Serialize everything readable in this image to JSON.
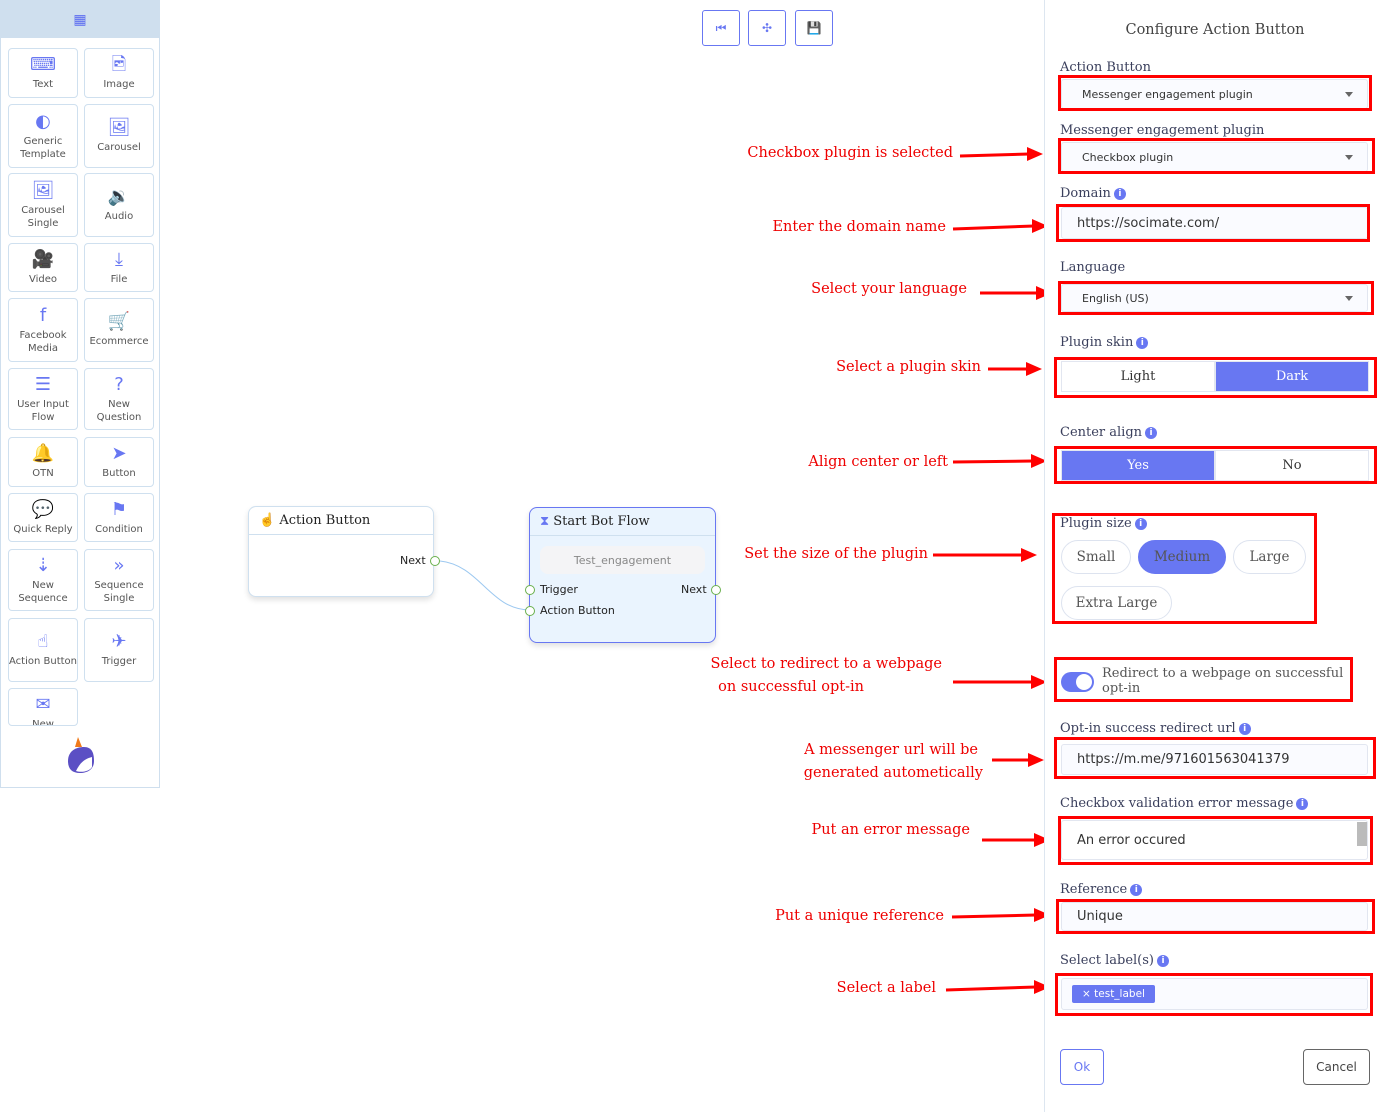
{
  "sidebar": {
    "items": [
      {
        "label": "Text",
        "icon": "keyboard-icon",
        "glyph": "⌨"
      },
      {
        "label": "Image",
        "icon": "file-image-icon",
        "glyph": "🖻"
      },
      {
        "label": "Generic Template",
        "icon": "half-circle-icon",
        "glyph": "◐"
      },
      {
        "label": "Carousel",
        "icon": "images-icon",
        "glyph": "🖼"
      },
      {
        "label": "Carousel Single",
        "icon": "image-icon",
        "glyph": "🖼"
      },
      {
        "label": "Audio",
        "icon": "file-audio-icon",
        "glyph": "🔉"
      },
      {
        "label": "Video",
        "icon": "file-video-icon",
        "glyph": "🎥"
      },
      {
        "label": "File",
        "icon": "file-download-icon",
        "glyph": "⤓"
      },
      {
        "label": "Facebook Media",
        "icon": "facebook-icon",
        "glyph": "f"
      },
      {
        "label": "Ecommerce",
        "icon": "cart-plus-icon",
        "glyph": "🛒"
      },
      {
        "label": "User Input Flow",
        "icon": "bars-icon",
        "glyph": "☰"
      },
      {
        "label": "New Question",
        "icon": "question-circle-icon",
        "glyph": "?"
      },
      {
        "label": "OTN",
        "icon": "bell-icon",
        "glyph": "🔔"
      },
      {
        "label": "Button",
        "icon": "paper-plane-icon",
        "glyph": "➤"
      },
      {
        "label": "Quick Reply",
        "icon": "comment-dots-icon",
        "glyph": "💬"
      },
      {
        "label": "Condition",
        "icon": "signs-icon",
        "glyph": "⚑"
      },
      {
        "label": "New Sequence",
        "icon": "sort-numeric-icon",
        "glyph": "⇣"
      },
      {
        "label": "Sequence Single",
        "icon": "double-chevron-right-icon",
        "glyph": "»"
      },
      {
        "label": "Action Button",
        "icon": "hand-pointer-icon",
        "glyph": "☝"
      },
      {
        "label": "Trigger",
        "icon": "plane-departure-icon",
        "glyph": "✈"
      },
      {
        "label": "New",
        "icon": "envelope-icon",
        "glyph": "✉"
      }
    ]
  },
  "toolbar": {
    "buttons": [
      {
        "icon": "skip-back-icon",
        "glyph": "⏮"
      },
      {
        "icon": "compress-icon",
        "glyph": "✣"
      },
      {
        "icon": "save-icon",
        "glyph": "💾"
      }
    ]
  },
  "canvas": {
    "node1": {
      "title": "Action Button",
      "output": "Next"
    },
    "node2": {
      "title": "Start Bot Flow",
      "input_value": "Test_engagement",
      "inputs": [
        "Trigger",
        "Action Button"
      ],
      "output": "Next"
    }
  },
  "annotations": [
    "Checkbox plugin is selected",
    "Enter the domain name",
    "Select your language",
    "Select a plugin skin",
    "Align center or left",
    "Set the size of the plugin",
    "Select to redirect to a webpage",
    "on successful opt-in",
    "A messenger url will be",
    "generated autometically",
    "Put an error message",
    "Put a unique reference",
    "Select a label"
  ],
  "panel": {
    "title": "Configure Action Button",
    "action_button_label": "Action Button",
    "action_button_value": "Messenger engagement plugin",
    "plugin_label": "Messenger engagement plugin",
    "plugin_value": "Checkbox plugin",
    "domain_label": "Domain",
    "domain_value": "https://socimate.com/",
    "language_label": "Language",
    "language_value": "English (US)",
    "skin_label": "Plugin skin",
    "skin_options": [
      "Light",
      "Dark"
    ],
    "skin_selected": "Dark",
    "align_label": "Center align",
    "align_options": [
      "Yes",
      "No"
    ],
    "align_selected": "Yes",
    "size_label": "Plugin size",
    "size_options": [
      "Small",
      "Medium",
      "Large",
      "Extra Large"
    ],
    "size_selected": "Medium",
    "redirect_toggle_label": "Redirect to a webpage on successful opt-in",
    "redirect_toggle_on": true,
    "redirect_url_label": "Opt-in success redirect url",
    "redirect_url_value": "https://m.me/971601563041379",
    "error_label": "Checkbox validation error message",
    "error_value": "An error occured",
    "reference_label": "Reference",
    "reference_value": "Unique",
    "labels_label": "Select label(s)",
    "labels": [
      "test_label"
    ],
    "ok": "Ok",
    "cancel": "Cancel"
  },
  "colors": {
    "accent": "#6877f2",
    "annotation": "#ff0000"
  }
}
